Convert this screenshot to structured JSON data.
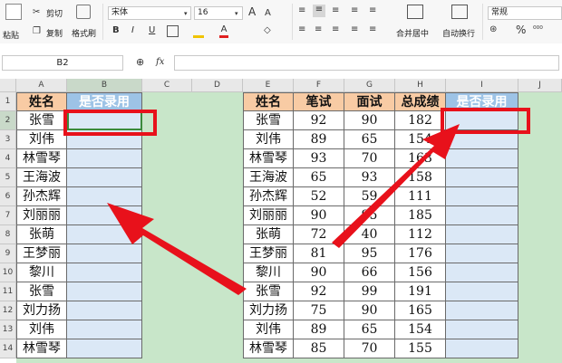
{
  "ribbon": {
    "paste": "粘贴",
    "cut": "剪切",
    "copy": "复制",
    "format_painter": "格式刷",
    "font_name": "宋体",
    "font_size": "16",
    "grow_font": "A",
    "shrink_font": "A",
    "bold": "B",
    "italic": "I",
    "underline": "U",
    "font_color_label": "A",
    "merge_center": "合并居中",
    "wrap_text": "自动换行",
    "number_format": "常规",
    "percent": "%"
  },
  "formula_bar": {
    "name_box": "B2",
    "fx": "fx",
    "zoom_icon": "zoom-icon"
  },
  "sheet": {
    "columns": [
      "A",
      "B",
      "C",
      "D",
      "E",
      "F",
      "G",
      "H",
      "I",
      "J"
    ],
    "rows": [
      "1",
      "2",
      "3",
      "4",
      "5",
      "6",
      "7",
      "8",
      "9",
      "10",
      "11",
      "12",
      "13",
      "14"
    ],
    "left_table": {
      "headers": [
        "姓名",
        "是否录用"
      ],
      "names": [
        "张雪",
        "刘伟",
        "林雪琴",
        "王海波",
        "孙杰辉",
        "刘丽丽",
        "张萌",
        "王梦丽",
        "黎川",
        "张雪",
        "刘力扬",
        "刘伟",
        "林雪琴"
      ]
    },
    "right_table": {
      "headers": [
        "姓名",
        "笔试",
        "面试",
        "总成绩",
        "是否录用"
      ],
      "rows": [
        [
          "张雪",
          "92",
          "90",
          "182"
        ],
        [
          "刘伟",
          "89",
          "65",
          "154"
        ],
        [
          "林雪琴",
          "93",
          "70",
          "163"
        ],
        [
          "王海波",
          "65",
          "93",
          "158"
        ],
        [
          "孙杰辉",
          "52",
          "59",
          "111"
        ],
        [
          "刘丽丽",
          "90",
          "95",
          "185"
        ],
        [
          "张萌",
          "72",
          "40",
          "112"
        ],
        [
          "王梦丽",
          "81",
          "95",
          "176"
        ],
        [
          "黎川",
          "90",
          "66",
          "156"
        ],
        [
          "张雪",
          "92",
          "99",
          "191"
        ],
        [
          "刘力扬",
          "75",
          "90",
          "165"
        ],
        [
          "刘伟",
          "89",
          "65",
          "154"
        ],
        [
          "林雪琴",
          "85",
          "70",
          "155"
        ]
      ]
    }
  },
  "colors": {
    "header_orange": "#f8cba4",
    "header_blue": "#9dc3e6",
    "cell_blue": "#dbe8f6",
    "background_green": "#c8e6c9",
    "annotation_red": "#e8111b"
  }
}
